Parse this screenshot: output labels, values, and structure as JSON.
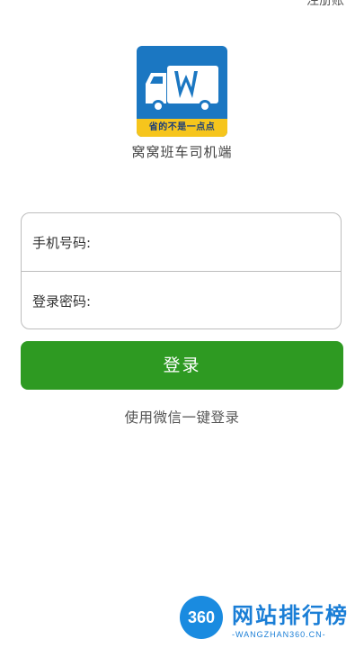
{
  "topbar": {
    "cut_text": "注册账"
  },
  "app": {
    "slogan": "省的不是一点点",
    "name": "窝窝班车司机端"
  },
  "form": {
    "phone_label": "手机号码:",
    "password_label": "登录密码:",
    "phone_value": "",
    "password_value": ""
  },
  "actions": {
    "login_label": "登录",
    "wechat_login_label": "使用微信一键登录"
  },
  "watermark": {
    "badge": "360",
    "title": "网站排行榜",
    "sub": "-WANGZHAN360.CN-"
  },
  "colors": {
    "primary_green": "#2e9a22",
    "icon_blue": "#1b77c2",
    "icon_yellow": "#f6c51c"
  }
}
